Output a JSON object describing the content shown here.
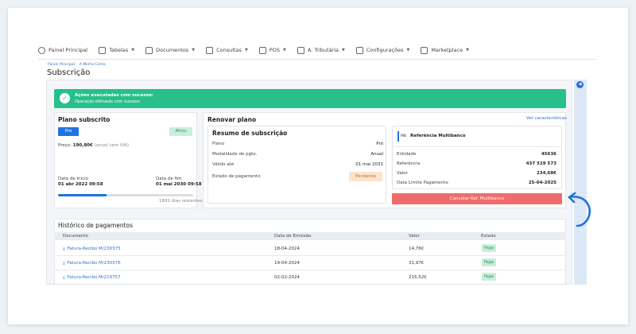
{
  "nav": {
    "items": [
      {
        "label": "Painel Principal",
        "icon": "dashboard-icon",
        "chevron": false
      },
      {
        "label": "Tabelas",
        "icon": "table-icon",
        "chevron": true
      },
      {
        "label": "Documentos",
        "icon": "document-icon",
        "chevron": true
      },
      {
        "label": "Consultas",
        "icon": "chart-icon",
        "chevron": true
      },
      {
        "label": "POS",
        "icon": "pos-icon",
        "chevron": true
      },
      {
        "label": "A. Tributária",
        "icon": "tax-icon",
        "chevron": true
      },
      {
        "label": "Configurações",
        "icon": "settings-icon",
        "chevron": true
      },
      {
        "label": "Marketplace",
        "icon": "marketplace-icon",
        "chevron": true
      }
    ]
  },
  "breadcrumb": {
    "home": "Painel Principal",
    "current": "A Minha Conta"
  },
  "page_title": "Subscrição",
  "alert": {
    "title": "Ações executadas com sucesso:",
    "message": "Operação efetuada com sucesso"
  },
  "plan": {
    "title": "Plano subscrito",
    "plan_badge": "Pro",
    "status_badge": "Ativo",
    "price_label": "Preço:",
    "price_value": "190,80€",
    "price_note": "(anual sem IVA)",
    "start_label": "Data de início",
    "start_value": "01 abr 2022 09:58",
    "end_label": "Data de fim",
    "end_value": "01 mai 2030 09:58",
    "progress_fraction": 0.36,
    "days_left": "1891 dias restantes"
  },
  "renew": {
    "title": "Renovar plano",
    "view_features": "Ver características",
    "summary_title": "Resumo de subscrição",
    "rows": [
      {
        "label": "Plano",
        "value": "Pro"
      },
      {
        "label": "Modalidade de pgto.",
        "value": "Anual"
      },
      {
        "label": "Válido até",
        "value": "01 mai 2031"
      },
      {
        "label": "Estado de pagamento",
        "value": "Pendente"
      }
    ]
  },
  "multibanco": {
    "logo_text": "MB",
    "title": "Referência Multibanco",
    "rows": [
      {
        "label": "Entidade",
        "value": "45636"
      },
      {
        "label": "Referência",
        "value": "437 519 573"
      },
      {
        "label": "Valor",
        "value": "234,68€"
      },
      {
        "label": "Data Limite Pagamento",
        "value": "25-04-2025"
      }
    ],
    "cancel_label": "Cancelar Ref. Multibanco"
  },
  "history": {
    "title": "Histórico de pagamentos",
    "columns": [
      "Documento",
      "Data de Emissão",
      "Valor",
      "Estado"
    ],
    "rows": [
      {
        "doc": "Fatura-Recibo M/230375",
        "date": "18-04-2024",
        "value": "14,76€",
        "status": "Paga"
      },
      {
        "doc": "Fatura-Recibo M/230376",
        "date": "19-04-2024",
        "value": "31,97€",
        "status": "Paga"
      },
      {
        "doc": "Fatura-Recibo M/219757",
        "date": "02-02-2024",
        "value": "215,52€",
        "status": "Paga"
      }
    ]
  },
  "colors": {
    "primary": "#1f73e0",
    "success": "#27c08a",
    "danger": "#f06c6c"
  }
}
